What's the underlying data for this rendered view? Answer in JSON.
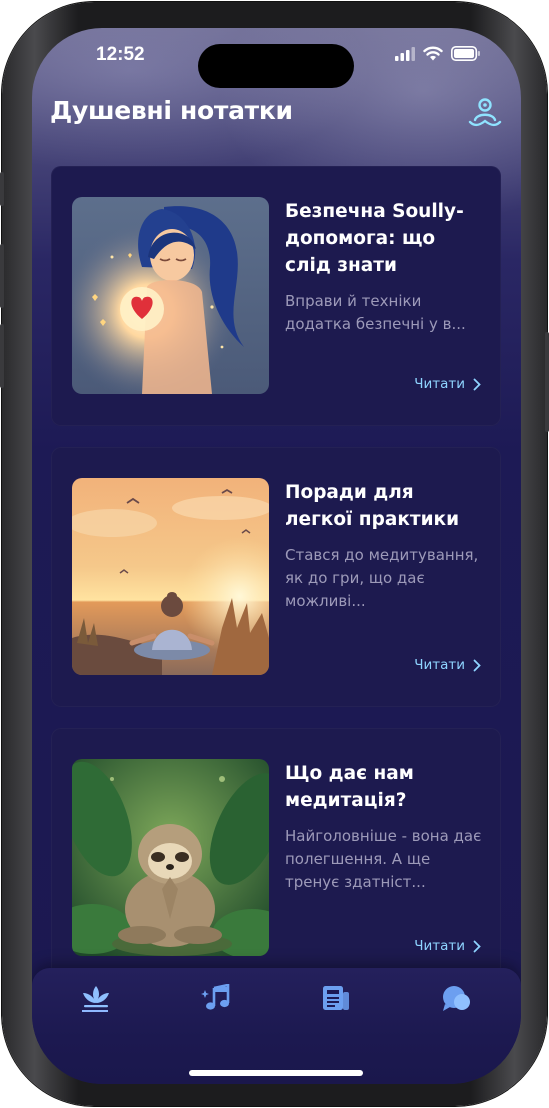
{
  "status_bar": {
    "time": "12:52"
  },
  "header": {
    "title": "Душевні нотатки",
    "profile_icon": "lotus-person-icon"
  },
  "articles": [
    {
      "title": "Безпечна Soully-допомога: що слід знати",
      "excerpt": "Вправи й техніки додатка безпечні у в...",
      "read_label": "Читати",
      "image": "girl-with-glowing-heart-illustration"
    },
    {
      "title": "Поради для легкої практики",
      "excerpt": "Стався до медитування, як до гри, що дає можливі...",
      "read_label": "Читати",
      "image": "girl-meditating-at-sunset-illustration"
    },
    {
      "title": "Що дає нам медитація?",
      "excerpt": "Найголовніше - вона дає полегшення. А ще тренує здатніст...",
      "read_label": "Читати",
      "image": "meditating-sloth-in-jungle-illustration"
    }
  ],
  "tabbar": {
    "tabs": [
      {
        "name": "home",
        "icon": "lotus-icon",
        "active": true
      },
      {
        "name": "music",
        "icon": "music-sparkle-icon",
        "active": false
      },
      {
        "name": "notes",
        "icon": "newspaper-icon",
        "active": false
      },
      {
        "name": "chat",
        "icon": "chat-bubbles-icon",
        "active": false
      }
    ]
  },
  "colors": {
    "background": "#1d1a55",
    "card": "#1d1a4f",
    "accent": "#8fd4ff",
    "text_primary": "#ffffff",
    "text_secondary": "#9d9ab9"
  }
}
